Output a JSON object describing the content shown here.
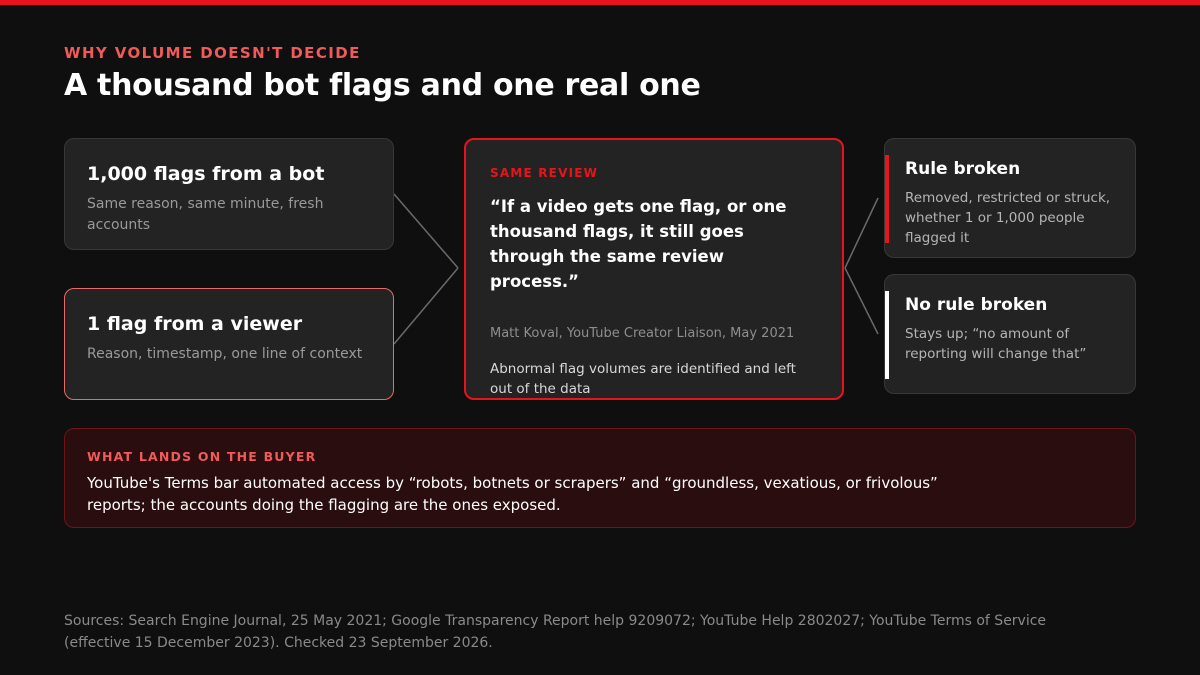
{
  "kicker": "WHY VOLUME DOESN'T DECIDE",
  "title": "A thousand bot flags and one real one",
  "inputs": {
    "bot": {
      "title": "1,000 flags from a bot",
      "subtitle": "Same reason, same minute, fresh accounts"
    },
    "viewer": {
      "title": "1 flag from a viewer",
      "subtitle": "Reason, timestamp, one line of context"
    }
  },
  "review": {
    "label": "SAME REVIEW",
    "quote": "“If a video gets one flag, or one thousand flags, it still goes through the same review process.”",
    "attribution": "Matt Koval, YouTube Creator Liaison, May 2021",
    "note": "Abnormal flag volumes are identified and left out of the data"
  },
  "outcomes": {
    "broken": {
      "title": "Rule broken",
      "text": "Removed, restricted or struck, whether 1 or 1,000 people flagged it"
    },
    "unbroken": {
      "title": "No rule broken",
      "text": "Stays up; “no amount of reporting will change that”"
    }
  },
  "buyer": {
    "label": "WHAT LANDS ON THE BUYER",
    "text": "YouTube's Terms bar automated access by “robots, botnets or scrapers” and “groundless, vexatious, or frivolous” reports; the accounts doing the flagging are the ones exposed."
  },
  "sources": "Sources: Search Engine Journal, 25 May 2021; Google Transparency Report help 9209072; YouTube Help 2802027; YouTube Terms of Service (effective 15 December 2023). Checked 23 September 2026.",
  "colors": {
    "accent": "#e8141c",
    "kicker": "#f25a5a",
    "background": "#0f0f0f"
  }
}
